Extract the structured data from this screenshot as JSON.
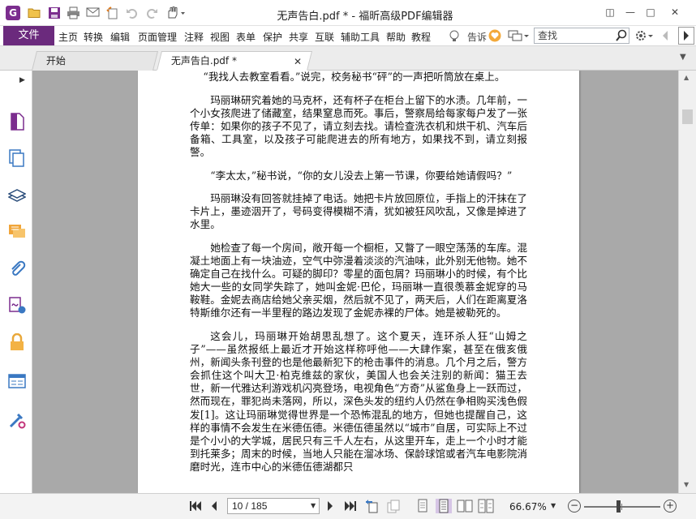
{
  "window": {
    "title": "无声告白.pdf * - 福昕高级PDF编辑器",
    "minimize": "—",
    "restore": "□",
    "close": "✕",
    "ribbon_toggle": "◫"
  },
  "quick_access": {
    "logo": "G",
    "icons": [
      "folder-open-icon",
      "save-icon",
      "print-icon",
      "email-icon",
      "new-icon",
      "undo-icon",
      "redo-icon",
      "hand-tool-icon"
    ]
  },
  "menu": {
    "file": "文件",
    "items": [
      "主页",
      "转换",
      "编辑",
      "页面管理",
      "注释",
      "视图",
      "表单",
      "保护",
      "共享",
      "互联",
      "辅助工具",
      "帮助",
      "教程"
    ],
    "tell_me": "告诉",
    "search_placeholder": "查找"
  },
  "tabs": {
    "home": "开始",
    "doc": "无声告白.pdf *",
    "close": "✕"
  },
  "sidebar": {
    "icons": [
      "page-thumbnail-icon",
      "pages-icon",
      "layers-icon",
      "comments-icon",
      "attachments-icon",
      "signature-icon",
      "security-icon",
      "form-fields-icon",
      "tools-icon"
    ]
  },
  "document": {
    "paragraphs": [
      "“我找人去教室看看。”说完，校务秘书“砰”的一声把听筒放在桌上。",
      "玛丽琳研究着她的马克杯，还有杯子在柜台上留下的水渍。几年前，一个小女孩爬进了储藏室，结果窒息而死。事后，警察局给每家每户发了一张传单：如果你的孩子不见了，请立刻去找。请检查洗衣机和烘干机、汽车后备箱、工具室，以及孩子可能爬进去的所有地方，如果找不到，请立刻报警。",
      "“李太太，”秘书说，“你的女儿没去上第一节课，你要给她请假吗？”",
      "玛丽琳没有回答就挂掉了电话。她把卡片放回原位，手指上的汗抹在了卡片上，墨迹洇开了，号码变得模糊不清，犹如被狂风吹乱，又像是掉进了水里。",
      "她检查了每一个房间，敞开每一个橱柜，又瞥了一眼空荡荡的车库。混凝土地面上有一块油迹，空气中弥漫着淡淡的汽油味，此外别无他物。她不确定自己在找什么。可疑的脚印？零星的面包屑？玛丽琳小的时候，有个比她大一些的女同学失踪了，她叫金妮·巴伦，玛丽琳一直很羡慕金妮穿的马鞍鞋。金妮去商店给她父亲买烟，然后就不见了，两天后，人们在距离夏洛特斯维尔还有一半里程的路边发现了金妮赤裸的尸体。她是被勒死的。",
      "这会儿，玛丽琳开始胡思乱想了。这个夏天，连环杀人狂“山姆之子”——虽然报纸上最近才开始这样称呼他——大肆作案，甚至在俄亥俄州，新闻头条刊登的也是他最新犯下的枪击事件的消息。几个月之后，警方会抓住这个叫大卫·柏克维兹的家伙，美国人也会关注别的新闻：猫王去世，新一代雅达利游戏机闪亮登场，电视角色“方奇”从鲨鱼身上一跃而过，然而现在，罪犯尚未落网，所以，深色头发的纽约人仍然在争相购买浅色假发[1]。这让玛丽琳觉得世界是一个恐怖混乱的地方，但她也提醒自己，这样的事情不会发生在米德伍德。米德伍德虽然以“城市”自居，可实际上不过是个小小的大学城，居民只有三千人左右，从这里开车，走上一个小时才能到托莱多；周末的时候，当地人只能在溜冰场、保龄球馆或者汽车电影院消磨时光，连市中心的米德伍德湖都只"
    ]
  },
  "status": {
    "page_value": "10 / 185",
    "zoom": "66.67%",
    "zoom_out": "−",
    "zoom_in": "+",
    "zoom_fraction": 0.45
  }
}
